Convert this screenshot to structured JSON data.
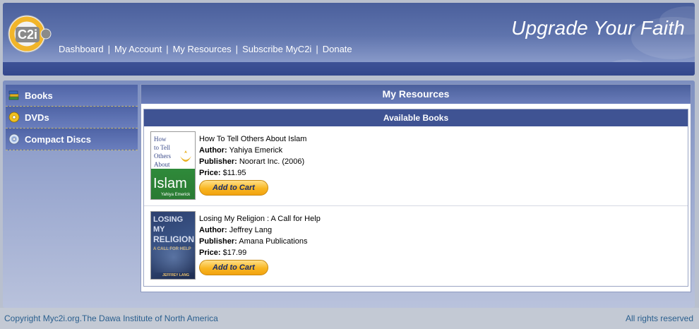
{
  "header": {
    "logo_text": "C2i",
    "tagline": "Upgrade Your Faith",
    "nav": [
      {
        "label": "Dashboard"
      },
      {
        "label": "My Account"
      },
      {
        "label": "My Resources"
      },
      {
        "label": "Subscribe MyC2i"
      },
      {
        "label": "Donate"
      }
    ],
    "nav_separator": "|"
  },
  "sidebar": {
    "items": [
      {
        "label": "Books",
        "icon": "books-icon"
      },
      {
        "label": "DVDs",
        "icon": "dvd-icon"
      },
      {
        "label": "Compact Discs",
        "icon": "cd-icon"
      }
    ]
  },
  "main": {
    "title": "My Resources",
    "section_title": "Available Books",
    "books": [
      {
        "title": "How To Tell Others About Islam",
        "author_label": "Author:",
        "author": "Yahiya Emerick",
        "publisher_label": "Publisher:",
        "publisher": "Noorart Inc. (2006)",
        "price_label": "Price:",
        "price": "$11.95",
        "cart_label": "Add to Cart",
        "cover_lines": [
          "How",
          "to Tell",
          "Others",
          "About",
          "Islam",
          "Yahiya Emerick"
        ]
      },
      {
        "title": "Losing My Religion : A Call for Help",
        "author_label": "Author:",
        "author": "Jeffrey Lang",
        "publisher_label": "Publisher:",
        "publisher": "Amana Publications",
        "price_label": "Price:",
        "price": "$17.99",
        "cart_label": "Add to Cart",
        "cover_lines": [
          "LOSING MY",
          "RELIGION",
          "A CALL FOR HELP",
          "JEFFREY LANG"
        ]
      }
    ]
  },
  "footer": {
    "copyright": "Copyright Myc2i.org.The Dawa Institute of North America",
    "rights": "All rights reserved"
  },
  "colors": {
    "header_dark": "#4a5f9c",
    "accent_orange": "#f8b622",
    "footer_text": "#2a5f8e"
  }
}
